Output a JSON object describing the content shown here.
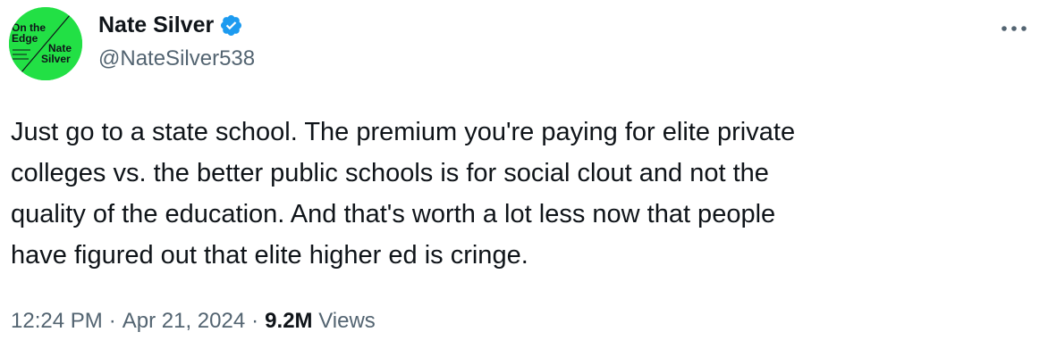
{
  "author": {
    "display_name": "Nate Silver",
    "handle": "@NateSilver538",
    "verified": true,
    "avatar": {
      "bg_color": "#22e045",
      "text_lines": [
        "On the",
        "Edge",
        "Nate",
        "Silver"
      ]
    }
  },
  "menu": {
    "icon": "more-icon"
  },
  "tweet": {
    "lines": [
      "Just go to a state school. The premium you're paying for elite private",
      "colleges vs. the better public schools is for social clout and not the",
      "quality of the education. And that's worth a lot less now that people",
      "have figured out that elite higher ed is cringe."
    ]
  },
  "meta": {
    "time": "12:24 PM",
    "separator": "·",
    "date": "Apr 21, 2024",
    "views_count": "9.2M",
    "views_label": "Views"
  },
  "colors": {
    "text": "#0f1419",
    "secondary": "#536471",
    "verified_badge": "#1d9bf0"
  }
}
